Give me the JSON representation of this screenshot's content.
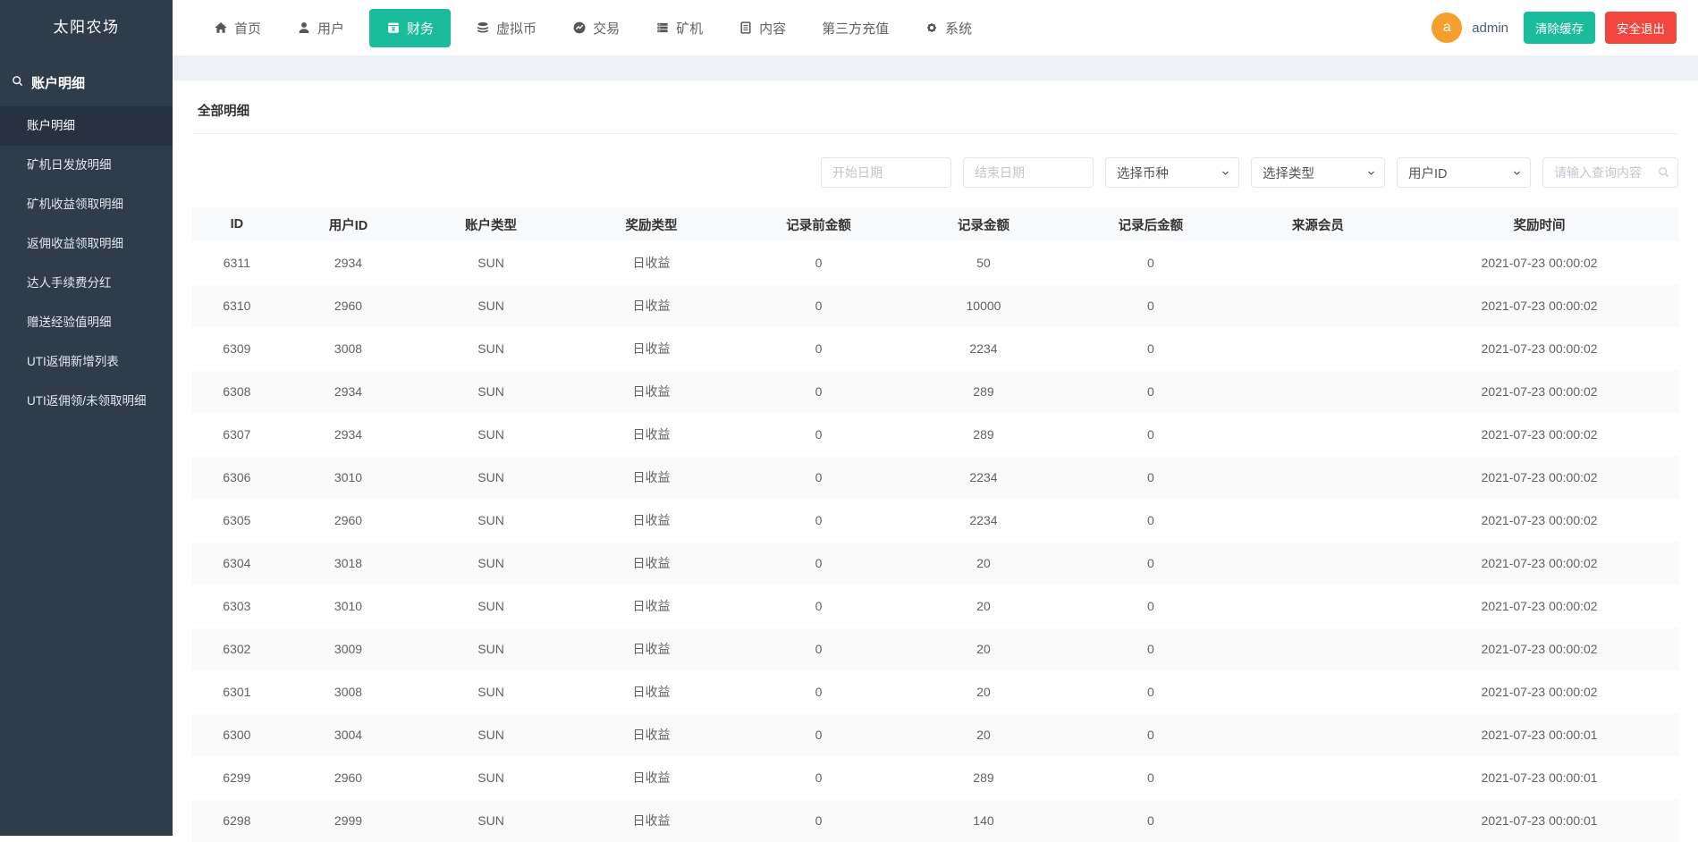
{
  "app": {
    "title": "太阳农场"
  },
  "topnav": {
    "items": [
      {
        "label": "首页",
        "icon": "home",
        "active": false
      },
      {
        "label": "用户",
        "icon": "user",
        "active": false
      },
      {
        "label": "财务",
        "icon": "finance",
        "active": true
      },
      {
        "label": "虚拟币",
        "icon": "coins",
        "active": false
      },
      {
        "label": "交易",
        "icon": "trade",
        "active": false
      },
      {
        "label": "矿机",
        "icon": "miner",
        "active": false
      },
      {
        "label": "内容",
        "icon": "content",
        "active": false
      },
      {
        "label": "第三方充值",
        "icon": null,
        "active": false
      },
      {
        "label": "系统",
        "icon": "gear",
        "active": false
      }
    ],
    "user": {
      "avatar_letter": "a",
      "name": "admin"
    },
    "clear_cache_label": "清除缓存",
    "logout_label": "安全退出"
  },
  "sidebar": {
    "section_label": "账户明细",
    "items": [
      {
        "label": "账户明细",
        "active": true
      },
      {
        "label": "矿机日发放明细",
        "active": false
      },
      {
        "label": "矿机收益领取明细",
        "active": false
      },
      {
        "label": "返佣收益领取明细",
        "active": false
      },
      {
        "label": "达人手续费分红",
        "active": false
      },
      {
        "label": "赠送经验值明细",
        "active": false
      },
      {
        "label": "UTI返佣新增列表",
        "active": false
      },
      {
        "label": "UTI返佣领/未领取明细",
        "active": false
      }
    ]
  },
  "main": {
    "tab_label": "全部明细",
    "filters": {
      "start_date_placeholder": "开始日期",
      "end_date_placeholder": "结束日期",
      "currency_select_value": "选择币种",
      "type_select_value": "选择类型",
      "userid_select_value": "用户ID",
      "search_placeholder": "请输入查询内容"
    },
    "table": {
      "headers": [
        "ID",
        "用户ID",
        "账户类型",
        "奖励类型",
        "记录前金额",
        "记录金额",
        "记录后金额",
        "来源会员",
        "奖励时间"
      ],
      "rows": [
        [
          "6311",
          "2934",
          "SUN",
          "日收益",
          "0",
          "50",
          "0",
          "",
          "2021-07-23 00:00:02"
        ],
        [
          "6310",
          "2960",
          "SUN",
          "日收益",
          "0",
          "10000",
          "0",
          "",
          "2021-07-23 00:00:02"
        ],
        [
          "6309",
          "3008",
          "SUN",
          "日收益",
          "0",
          "2234",
          "0",
          "",
          "2021-07-23 00:00:02"
        ],
        [
          "6308",
          "2934",
          "SUN",
          "日收益",
          "0",
          "289",
          "0",
          "",
          "2021-07-23 00:00:02"
        ],
        [
          "6307",
          "2934",
          "SUN",
          "日收益",
          "0",
          "289",
          "0",
          "",
          "2021-07-23 00:00:02"
        ],
        [
          "6306",
          "3010",
          "SUN",
          "日收益",
          "0",
          "2234",
          "0",
          "",
          "2021-07-23 00:00:02"
        ],
        [
          "6305",
          "2960",
          "SUN",
          "日收益",
          "0",
          "2234",
          "0",
          "",
          "2021-07-23 00:00:02"
        ],
        [
          "6304",
          "3018",
          "SUN",
          "日收益",
          "0",
          "20",
          "0",
          "",
          "2021-07-23 00:00:02"
        ],
        [
          "6303",
          "3010",
          "SUN",
          "日收益",
          "0",
          "20",
          "0",
          "",
          "2021-07-23 00:00:02"
        ],
        [
          "6302",
          "3009",
          "SUN",
          "日收益",
          "0",
          "20",
          "0",
          "",
          "2021-07-23 00:00:02"
        ],
        [
          "6301",
          "3008",
          "SUN",
          "日收益",
          "0",
          "20",
          "0",
          "",
          "2021-07-23 00:00:02"
        ],
        [
          "6300",
          "3004",
          "SUN",
          "日收益",
          "0",
          "20",
          "0",
          "",
          "2021-07-23 00:00:01"
        ],
        [
          "6299",
          "2960",
          "SUN",
          "日收益",
          "0",
          "289",
          "0",
          "",
          "2021-07-23 00:00:01"
        ],
        [
          "6298",
          "2999",
          "SUN",
          "日收益",
          "0",
          "140",
          "0",
          "",
          "2021-07-23 00:00:01"
        ]
      ]
    }
  },
  "colors": {
    "accent_green": "#1abc9c",
    "danger_red": "#f2453d",
    "avatar_orange": "#f5a02c",
    "sidebar_bg": "#2f3c4a",
    "band_gray": "#edf0f4"
  }
}
